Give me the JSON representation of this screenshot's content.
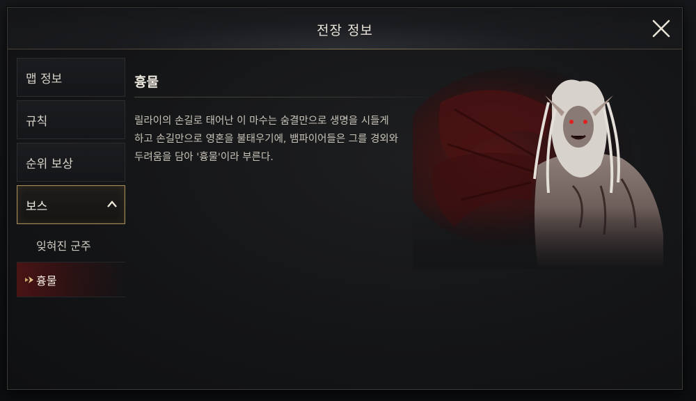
{
  "modal": {
    "title": "전장 정보",
    "close_icon": "close-icon"
  },
  "sidebar": {
    "items": [
      {
        "label": "맵 정보",
        "active": false
      },
      {
        "label": "규칙",
        "active": false
      },
      {
        "label": "순위 보상",
        "active": false
      },
      {
        "label": "보스",
        "active": true,
        "icon": "chevron-up-icon"
      }
    ],
    "sub_items": [
      {
        "label": "잊혀진 군주",
        "selected": false
      },
      {
        "label": "흉물",
        "selected": true,
        "icon": "arrow-right-icon"
      }
    ]
  },
  "content": {
    "title": "흉물",
    "description_lines": [
      "릴라이의 손길로 태어난 이 마수는 숨결만으로 생명을 시들게",
      "하고 손길만으로 영혼을 불태우기에, 뱀파이어들은 그를 경외와",
      "두려움을 담아 '흉물'이라 부른다."
    ]
  },
  "colors": {
    "accent_gold": "#a08a5c",
    "selected_red": "#781414",
    "text": "#d6d2c8"
  }
}
